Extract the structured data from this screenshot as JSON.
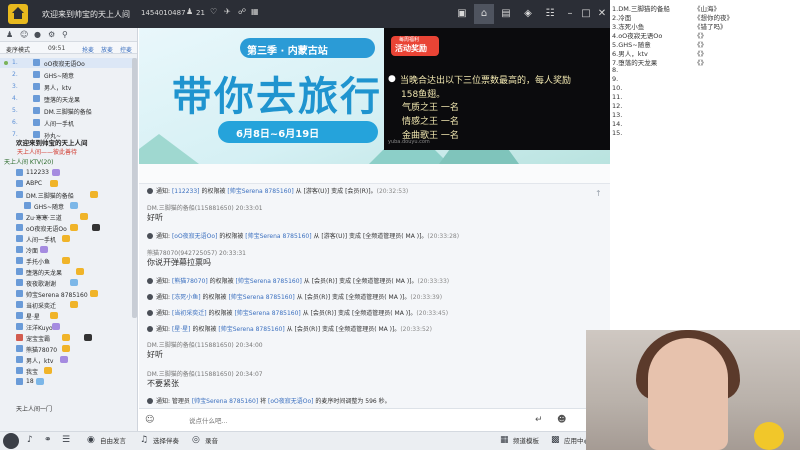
{
  "titlebar": {
    "title": "欢迎来到帅宝的天上人间",
    "room_id": "1454010487",
    "online_count": "21",
    "icons": [
      "user-icon",
      "heart-icon",
      "plane-icon",
      "share-icon",
      "grid-icon",
      "camera-icon",
      "home-icon",
      "window-icon",
      "game-icon",
      "skin-icon",
      "minimize-icon",
      "maximize-icon",
      "close-icon"
    ]
  },
  "sidebar": {
    "mode_label": "麦序模式",
    "mode_time": "09:51",
    "mode_links": [
      "抢麦",
      "放麦",
      "控麦"
    ],
    "queue": [
      {
        "num": "1.",
        "name": "oO夜寂无语Oo"
      },
      {
        "num": "2.",
        "name": "GHS~随意"
      },
      {
        "num": "3.",
        "name": "男人，ktv"
      },
      {
        "num": "4.",
        "name": "堕落的天龙果"
      },
      {
        "num": "5.",
        "name": "DM.三脚猫的备船"
      },
      {
        "num": "6.",
        "name": "人间一手机"
      },
      {
        "num": "7.",
        "name": "孙丸~"
      }
    ],
    "room_title": "欢迎来到帅宝的天上人间",
    "room_sub": "天上人间——彼此善待",
    "room_ktv": "天上人间  KTV(20)",
    "members": [
      {
        "name": "112233"
      },
      {
        "name": "ABPC"
      },
      {
        "name": "DM.三脚猫的备船"
      },
      {
        "name": "GHS~随意"
      },
      {
        "name": "Zu·寒寒·三道"
      },
      {
        "name": "oO夜寂无语Oo"
      },
      {
        "name": "人间一手机"
      },
      {
        "name": "冷面"
      },
      {
        "name": "手托小鱼"
      },
      {
        "name": "堕落的天龙果"
      },
      {
        "name": "夜夜歌谢谢"
      },
      {
        "name": "帅宝Serena 8785160"
      },
      {
        "name": "当初采奕迁"
      },
      {
        "name": "星·星"
      },
      {
        "name": "汪洋Kuyo"
      },
      {
        "name": "宠宝宝霸"
      },
      {
        "name": "熊猫78070"
      },
      {
        "name": "男人，ktv"
      },
      {
        "name": "我宝"
      },
      {
        "name": "18"
      }
    ],
    "bottom_label": "天上人间一门"
  },
  "banner": {
    "season": "第三季 · 内蒙古站",
    "title": "带你去旅行",
    "dates": "6月8日~6月19日"
  },
  "notice": {
    "tag": "每周福利",
    "title": "活动奖励",
    "bullet": "●",
    "line1": "当晚合达出以下三位票数最高的，每人奖励",
    "line2": "158鱼翅。",
    "prizes": [
      "气质之王 一名",
      "情感之王 一名",
      "金曲歌王 一名"
    ],
    "footer": "yuba.douyu.com"
  },
  "ranking": [
    {
      "rank": "1.",
      "singer": "DM.三脚猫的备船",
      "song": "《山海》"
    },
    {
      "rank": "2.",
      "singer": "冷面",
      "song": "《想你的夜》"
    },
    {
      "rank": "3.",
      "singer": "冻死小鱼",
      "song": "《错了吗》"
    },
    {
      "rank": "4.",
      "singer": "oO夜寂无语Oo",
      "song": "《》"
    },
    {
      "rank": "5.",
      "singer": "GHS~随意",
      "song": "《》"
    },
    {
      "rank": "6.",
      "singer": "男人，ktv",
      "song": "《》"
    },
    {
      "rank": "7.",
      "singer": "堕落的天龙果",
      "song": "《》"
    },
    {
      "rank": "8.",
      "singer": "",
      "song": ""
    },
    {
      "rank": "9.",
      "singer": "",
      "song": ""
    },
    {
      "rank": "10.",
      "singer": "",
      "song": ""
    },
    {
      "rank": "11.",
      "singer": "",
      "song": ""
    },
    {
      "rank": "12.",
      "singer": "",
      "song": ""
    },
    {
      "rank": "13.",
      "singer": "",
      "song": ""
    },
    {
      "rank": "14.",
      "singer": "",
      "song": ""
    },
    {
      "rank": "15.",
      "singer": "",
      "song": ""
    }
  ],
  "chat": {
    "messages": [
      {
        "kind": "notice",
        "pre": "通知: ",
        "who": "[112233]",
        "mid": " 的权限被 ",
        "by": "[帅宝Serena 8785160]",
        "rest": " 从 [游客(U)] 变成 [会员(R)]。",
        "time": "(20:32:53)"
      },
      {
        "kind": "say",
        "head": "DM.三脚猫的备船(115881650)  20:33:01",
        "body": "好听"
      },
      {
        "kind": "notice",
        "pre": "通知: ",
        "who": "[oO夜寂无语Oo]",
        "mid": " 的权限被 ",
        "by": "[帅宝Serena 8785160]",
        "rest": " 从 [游客(U)] 变成 [全频道管理员( MA )]。",
        "time": "(20:33:28)"
      },
      {
        "kind": "say",
        "head": "熊猫78070(942725057)  20:33:31",
        "body": "你说开弹幕拉票吗"
      },
      {
        "kind": "notice",
        "pre": "通知: ",
        "who": "[熊猫78070]",
        "mid": " 的权限被 ",
        "by": "[帅宝Serena 8785160]",
        "rest": " 从 [会员(R)] 变成 [全频道管理员( MA )]。",
        "time": "(20:33:33)"
      },
      {
        "kind": "notice",
        "pre": "通知: ",
        "who": "[冻死小鱼]",
        "mid": " 的权限被 ",
        "by": "[帅宝Serena 8785160]",
        "rest": " 从 [会员(R)] 变成 [全频道管理员( MA )]。",
        "time": "(20:33:39)"
      },
      {
        "kind": "notice",
        "pre": "通知: ",
        "who": "[当初采奕迁]",
        "mid": " 的权限被 ",
        "by": "[帅宝Serena 8785160]",
        "rest": " 从 [会员(R)] 变成 [全频道管理员( MA )]。",
        "time": "(20:33:45)"
      },
      {
        "kind": "notice",
        "pre": "通知: ",
        "who": "[星·星]",
        "mid": " 的权限被 ",
        "by": "[帅宝Serena 8785160]",
        "rest": " 从 [会员(R)] 变成 [全频道管理员( MA )]。",
        "time": "(20:33:52)"
      },
      {
        "kind": "say",
        "head": "DM.三脚猫的备船(115881650)  20:34:00",
        "body": "好听"
      },
      {
        "kind": "say",
        "head": "DM.三脚猫的备船(115881650)  20:34:07",
        "body": "不要紧张"
      },
      {
        "kind": "notice",
        "pre": "通知: 管理员 ",
        "who": "[帅宝Serena 8785160]",
        "mid": " 将 ",
        "by": "[oO夜寂无语Oo]",
        "rest": " 的麦序时间调整为 596 秒。",
        "time": ""
      }
    ]
  },
  "input": {
    "placeholder": "说点什么吧..."
  },
  "toolbar": {
    "buttons": [
      {
        "label": "自由发言",
        "icon": "speak-icon"
      },
      {
        "label": "选择伴奏",
        "icon": "music-icon"
      },
      {
        "label": "录音",
        "icon": "record-icon"
      }
    ],
    "right": [
      {
        "label": "频道模板",
        "icon": "template-icon"
      },
      {
        "label": "应用中心",
        "icon": "apps-icon"
      }
    ]
  }
}
